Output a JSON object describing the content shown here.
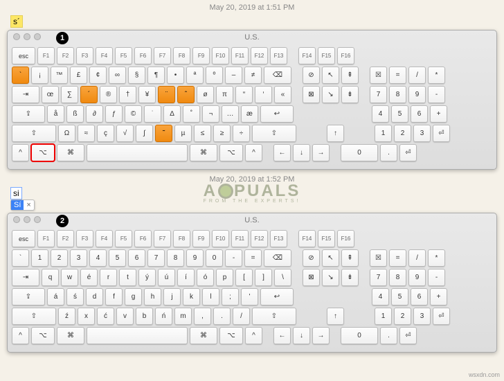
{
  "top": {
    "timestamp": "May 20, 2019 at 1:51 PM",
    "typed": "s´"
  },
  "mid": {
    "timestamp": "May 20, 2019 at 1:52 PM",
    "typed": "si",
    "suggestion": "Sí",
    "close": "×"
  },
  "viewer_label": "U.S.",
  "badge1": "1",
  "badge2": "2",
  "watermark": {
    "brand": "A  PUALS",
    "tag": "FROM  THE  EXPERTS!"
  },
  "site": "wsxdn.com",
  "fn_row": [
    "esc",
    "F1",
    "F2",
    "F3",
    "F4",
    "F5",
    "F6",
    "F7",
    "F8",
    "F9",
    "F10",
    "F11",
    "F12",
    "F13",
    "F14",
    "F15",
    "F16"
  ],
  "kbd1": {
    "r1": [
      "`",
      "¡",
      "™",
      "£",
      "¢",
      "∞",
      "§",
      "¶",
      "•",
      "ª",
      "º",
      "–",
      "≠",
      "⌫"
    ],
    "r2": [
      "⇥",
      "œ",
      "∑",
      "´",
      "®",
      "†",
      "¥",
      "¨",
      "ˆ",
      "ø",
      "π",
      "“",
      "‘",
      "«"
    ],
    "r3": [
      "⇪",
      "å",
      "ß",
      "∂",
      "ƒ",
      "©",
      "˙",
      "∆",
      "˚",
      "¬",
      "…",
      "æ",
      "↩"
    ],
    "r4": [
      "⇧",
      "Ω",
      "≈",
      "ç",
      "√",
      "∫",
      "˜",
      "µ",
      "≤",
      "≥",
      "÷",
      "⇧"
    ],
    "r5": [
      "^",
      "⌥",
      "⌘",
      " ",
      "⌘",
      "⌥",
      "^"
    ]
  },
  "kbd2": {
    "r1": [
      "`",
      "1",
      "2",
      "3",
      "4",
      "5",
      "6",
      "7",
      "8",
      "9",
      "0",
      "-",
      "=",
      "⌫"
    ],
    "r2": [
      "⇥",
      "q",
      "w",
      "é",
      "r",
      "t",
      "ý",
      "ú",
      "í",
      "ó",
      "p",
      "[",
      "]",
      "\\"
    ],
    "r3": [
      "⇪",
      "á",
      "ś",
      "d",
      "f",
      "g",
      "h",
      "j",
      "k",
      "l",
      ";",
      "'",
      "↩"
    ],
    "r4": [
      "⇧",
      "ź",
      "x",
      "ć",
      "v",
      "b",
      "ń",
      "m",
      ",",
      ".",
      "/",
      "⇧"
    ],
    "r5": [
      "^",
      "⌥",
      "⌘",
      " ",
      "⌘",
      "⌥",
      "^"
    ]
  },
  "nav1": [
    "⊘",
    "↖",
    "⇞"
  ],
  "nav2": [
    "⊠",
    "↘",
    "⇟"
  ],
  "arrows": {
    "up": "↑",
    "left": "←",
    "down": "↓",
    "right": "→"
  },
  "numpad": {
    "r0": [
      "☒",
      "=",
      "/",
      "*"
    ],
    "r1": [
      "7",
      "8",
      "9",
      "-"
    ],
    "r2": [
      "4",
      "5",
      "6",
      "+"
    ],
    "r3": [
      "1",
      "2",
      "3",
      "⏎"
    ],
    "r4": [
      "0",
      ".",
      "⏎"
    ]
  },
  "orange_idx": {
    "r1": [
      0
    ],
    "r2": [
      3,
      7,
      8
    ],
    "r3": [],
    "r4": [
      6
    ]
  },
  "red_outline": "r5_1"
}
